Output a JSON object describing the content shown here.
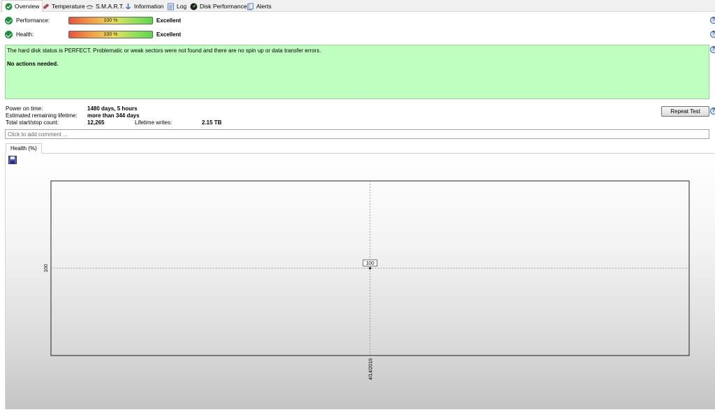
{
  "tabs": [
    {
      "label": "Overview",
      "icon": "check-circle-icon",
      "active": true
    },
    {
      "label": "Temperature",
      "icon": "thermometer-icon",
      "active": false
    },
    {
      "label": "S.M.A.R.T.",
      "icon": "smart-drive-icon",
      "active": false
    },
    {
      "label": "Information",
      "icon": "info-icon",
      "active": false
    },
    {
      "label": "Log",
      "icon": "log-icon",
      "active": false
    },
    {
      "label": "Disk Performance",
      "icon": "gauge-icon",
      "active": false
    },
    {
      "label": "Alerts",
      "icon": "alerts-icon",
      "active": false
    }
  ],
  "status": {
    "performance": {
      "label": "Performance:",
      "bar_text": "100 %",
      "percent": 100,
      "rating": "Excellent"
    },
    "health": {
      "label": "Health:",
      "bar_text": "100 %",
      "percent": 100,
      "rating": "Excellent"
    }
  },
  "message": {
    "line1": "The hard disk status is PERFECT. Problematic or weak sectors were not found and there are no spin up or data transfer errors.",
    "line2": "No actions needed."
  },
  "info": {
    "power_on_label": "Power on time:",
    "power_on_value": "1480 days, 5 hours",
    "lifetime_label": "Estimated remaining lifetime:",
    "lifetime_value": "more than 344 days",
    "startstop_label": "Total start/stop count:",
    "startstop_value": "12,265",
    "writes_label": "Lifetime writes:",
    "writes_value": "2.15 TB"
  },
  "repeat_button": "Repeat Test",
  "comment": {
    "placeholder": "Click to add comment ...",
    "value": ""
  },
  "chart_tab": "Health (%)",
  "colors": {
    "message_bg": "#bfffc0",
    "check": "#1f8f3a",
    "bar_start": "#e8513a",
    "bar_end": "#5fd64a"
  },
  "chart_data": {
    "type": "line",
    "series": [
      {
        "x": [
          "4/14/2019"
        ],
        "values": [
          100
        ]
      }
    ],
    "x_ticks": [
      "4/14/2019"
    ],
    "y_ticks": [
      100
    ],
    "point_labels": [
      "100"
    ],
    "grid": true
  }
}
